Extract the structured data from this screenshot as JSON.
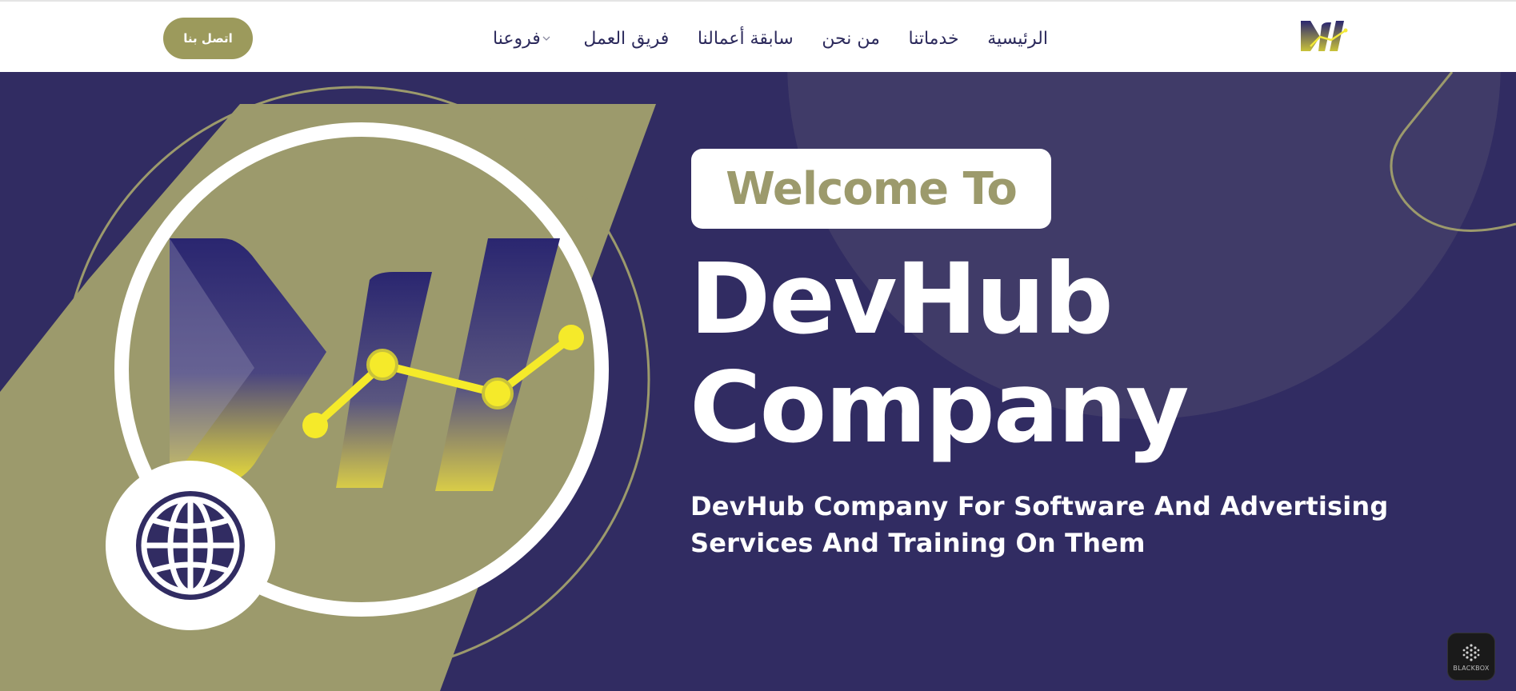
{
  "header": {
    "contact_button": "اتصل بنا",
    "nav": [
      {
        "label": "الرئيسية",
        "id": "home"
      },
      {
        "label": "خدماتنا",
        "id": "services"
      },
      {
        "label": "من نحن",
        "id": "about"
      },
      {
        "label": "سابقة أعمالنا",
        "id": "portfolio"
      },
      {
        "label": "فريق العمل",
        "id": "team"
      },
      {
        "label": "فروعنا",
        "id": "branches",
        "has_dropdown": true
      }
    ],
    "logo_icon": "devhub-logo-icon"
  },
  "hero": {
    "welcome": "Welcome To",
    "title_line1": "DevHub",
    "title_line2": "Company",
    "subtitle_line1": "DevHub Company For Software And Advertising",
    "subtitle_line2": "Services And Training On Them"
  },
  "widget": {
    "label": "BLACKBOX",
    "icon": "blackbox-cube-icon"
  },
  "colors": {
    "brand_navy": "#312c62",
    "brand_olive": "#9c9a5c",
    "accent_yellow": "#f2e93a",
    "nav_text": "#2c2a5c"
  }
}
